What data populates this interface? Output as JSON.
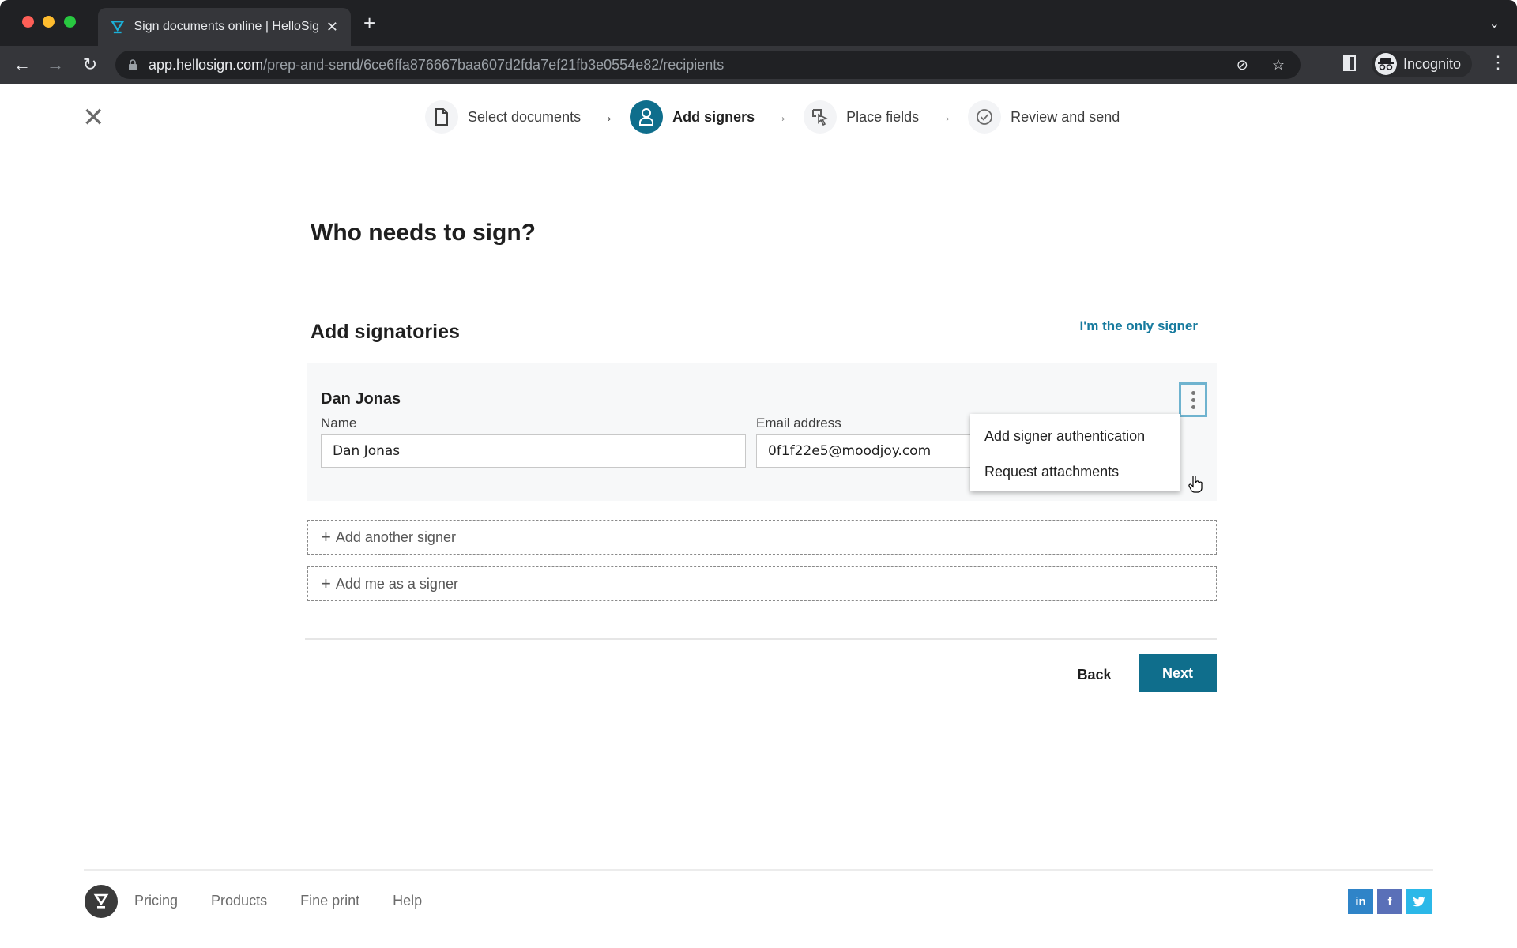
{
  "browser": {
    "tab_title": "Sign documents online | HelloSign",
    "tab_close": "✕",
    "new_tab": "+",
    "tab_list": "⌄",
    "url_host": "app.hellosign.com",
    "url_path": "/prep-and-send/6ce6ffa876667baa607d2fda7ef21fb3e0554e82/recipients",
    "profile_label": "Incognito",
    "nav_back": "←",
    "nav_forward": "→",
    "nav_reload": "↻",
    "menu": "⋮",
    "eye_off_icon": "⊘",
    "star_icon": "☆",
    "incognito_glyph": "👓"
  },
  "page": {
    "close_glyph": "✕",
    "steps": [
      {
        "label": "Select documents",
        "icon": "document-icon",
        "state": "done"
      },
      {
        "label": "Add signers",
        "icon": "person-icon",
        "state": "active"
      },
      {
        "label": "Place fields",
        "icon": "place-fields-icon",
        "state": "upcoming"
      },
      {
        "label": "Review and send",
        "icon": "check-circle-icon",
        "state": "upcoming"
      }
    ],
    "step_arrow": "→",
    "heading": "Who needs to sign?",
    "subheading": "Add signatories",
    "only_signer_link": "I'm the only signer",
    "signer": {
      "title": "Dan Jonas",
      "name_label": "Name",
      "name_value": "Dan Jonas",
      "email_label": "Email address",
      "email_value": "0f1f22e5@moodjoy.com"
    },
    "options_menu": {
      "items": [
        "Add signer authentication",
        "Request attachments"
      ]
    },
    "add_another_signer": "Add another signer",
    "add_me_as_signer": "Add me as a signer",
    "plus_glyph": "+",
    "back_label": "Back",
    "next_label": "Next"
  },
  "footer": {
    "links": [
      "Pricing",
      "Products",
      "Fine print",
      "Help"
    ],
    "social": {
      "linkedin": "in",
      "facebook": "f",
      "twitter": "t"
    }
  },
  "colors": {
    "brand": "#0f6e8c",
    "link": "#167a9e",
    "linkedin": "#2f84c8",
    "facebook": "#5a70b8",
    "twitter": "#2bb8e8"
  }
}
